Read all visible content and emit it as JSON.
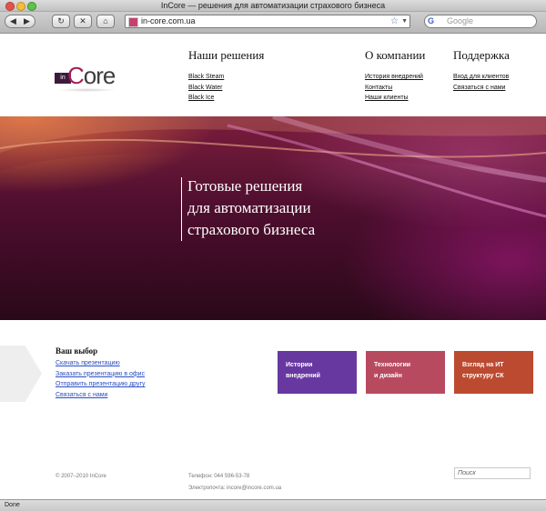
{
  "window": {
    "title": "InCore — решения для автоматизации страхового бизнеса"
  },
  "toolbar": {
    "back_icon": "◀",
    "forward_icon": "▶",
    "reload_icon": "↻",
    "stop_icon": "✕",
    "home_icon": "⌂",
    "url": "in-core.com.ua",
    "bookmark_icon": "☆",
    "search_placeholder": "Google",
    "search_engine_icon": "G"
  },
  "logo": {
    "box_text": "in",
    "text": "Core"
  },
  "nav": {
    "solutions": {
      "title": "Наши решения",
      "links": [
        "Black Steam",
        "Black Water",
        "Black Ice"
      ]
    },
    "company": {
      "title": "О компании",
      "links": [
        "История внедрений",
        "Контакты",
        "Наши клиенты"
      ]
    },
    "support": {
      "title": "Поддержка",
      "links": [
        "Вход для клиентов",
        "Связаться с нами"
      ]
    }
  },
  "hero": {
    "lines": [
      "Готовые решения",
      "для автоматизации",
      "страхового бизнеса"
    ]
  },
  "choice": {
    "title": "Ваш выбор",
    "links": [
      "Скачать презентацию",
      "Заказать презентацию в офис",
      "Отправить презентацию другу",
      "Связаться с нами"
    ]
  },
  "tiles": [
    {
      "line1": "Истории",
      "line2": "внедрений",
      "color": "#6838a1"
    },
    {
      "line1": "Технологии",
      "line2": "и дизайн",
      "color": "#b84a60"
    },
    {
      "line1": "Взгляд на ИТ",
      "line2": "структуру СК",
      "color": "#bc4a30"
    }
  ],
  "footer": {
    "copyright": "© 2007–2010 InCore",
    "phone": "Телефон: 044 596-53-78",
    "email": "Электропочта: incore@incore.com.ua",
    "search_placeholder": "Поиск"
  },
  "status": {
    "text": "Done"
  }
}
